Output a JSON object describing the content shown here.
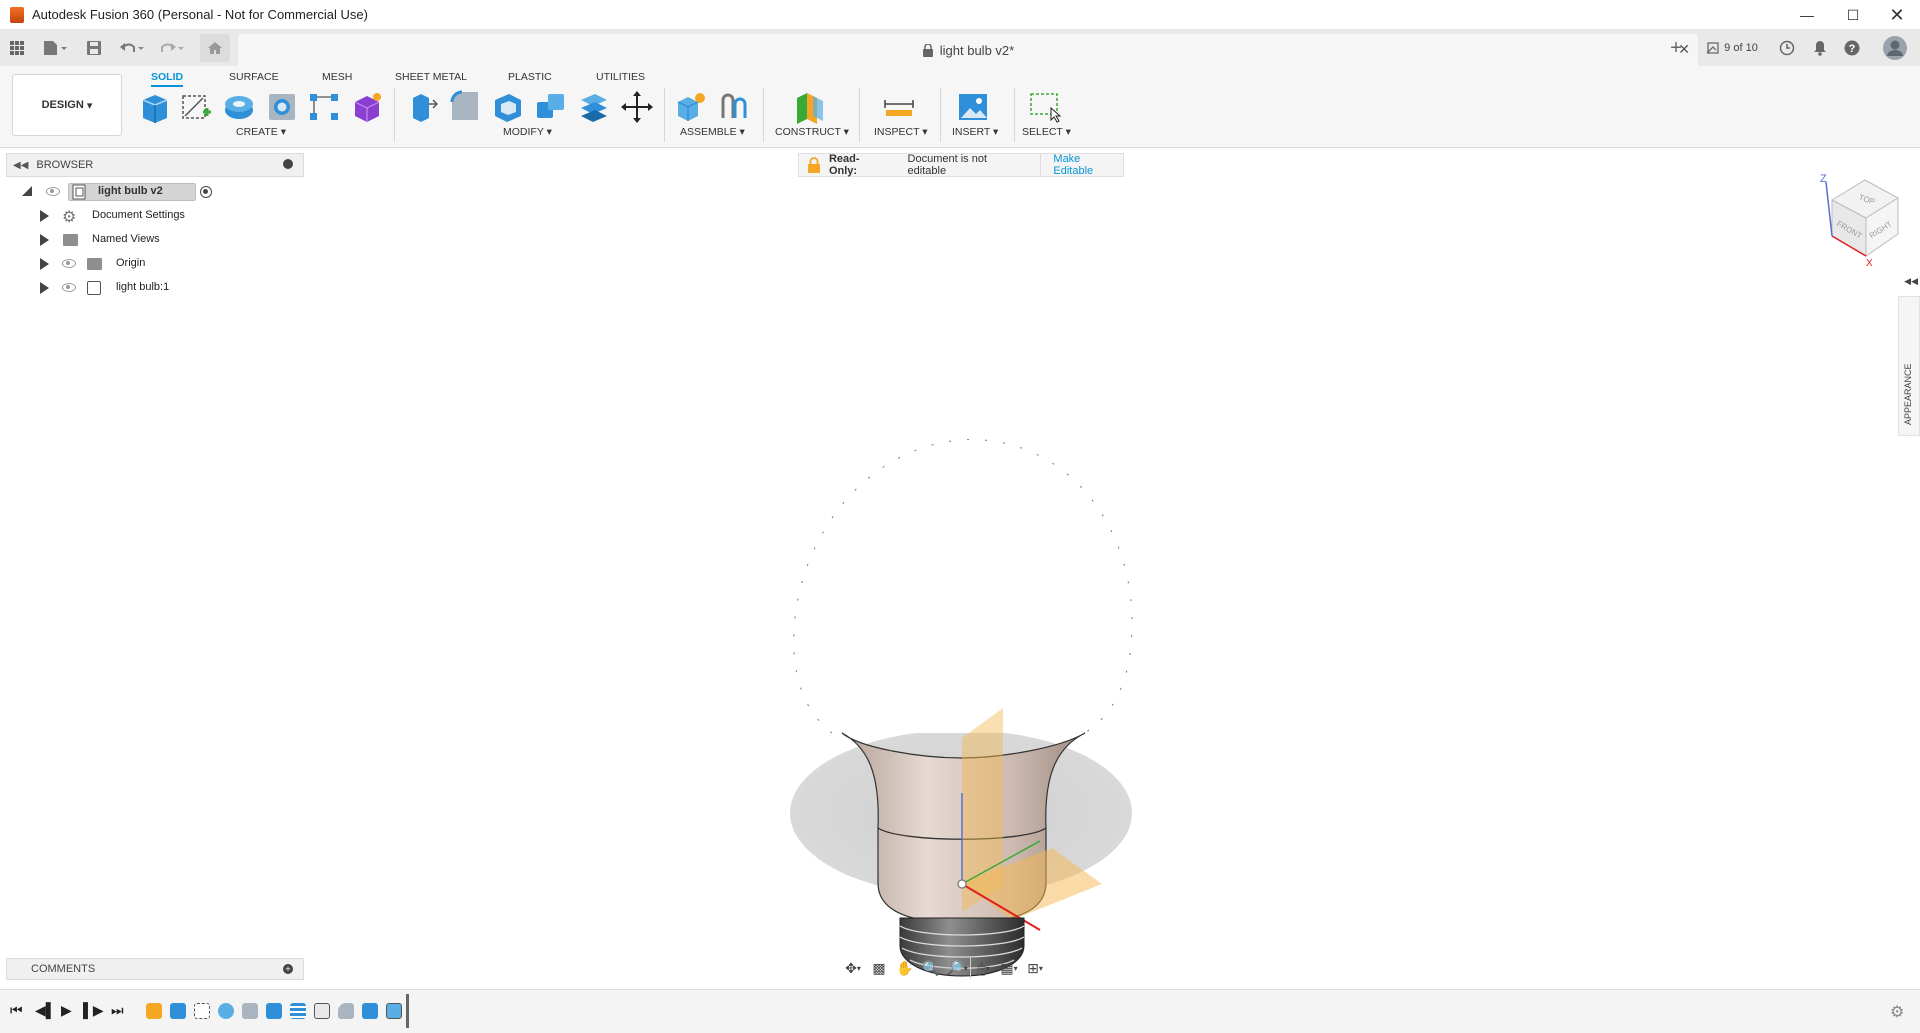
{
  "window": {
    "title": "Autodesk Fusion 360 (Personal - Not for Commercial Use)"
  },
  "tabbar": {
    "document_tab": "light bulb v2*",
    "job_status": "9 of 10"
  },
  "ribbon": {
    "workspace": "DESIGN",
    "tabs": [
      "SOLID",
      "SURFACE",
      "MESH",
      "SHEET METAL",
      "PLASTIC",
      "UTILITIES"
    ],
    "groups": [
      "CREATE",
      "MODIFY",
      "ASSEMBLE",
      "CONSTRUCT",
      "INSPECT",
      "INSERT",
      "SELECT"
    ]
  },
  "browser": {
    "title": "BROWSER",
    "root": "light bulb v2",
    "items": [
      "Document Settings",
      "Named Views",
      "Origin",
      "light bulb:1"
    ]
  },
  "readonly": {
    "label": "Read-Only:",
    "message": "Document is not editable",
    "action": "Make Editable"
  },
  "viewcube": {
    "top": "TOP",
    "front": "FRONT",
    "right": "RIGHT",
    "axis_z": "Z",
    "axis_x": "X"
  },
  "side_panel": {
    "appearance": "APPEARANCE"
  },
  "comments": {
    "title": "COMMENTS"
  },
  "colors": {
    "accent": "#0696d7",
    "fusion_orange": "#f37021",
    "bulb_base": "#c9b6ab",
    "origin_plane": "#f5b850"
  }
}
